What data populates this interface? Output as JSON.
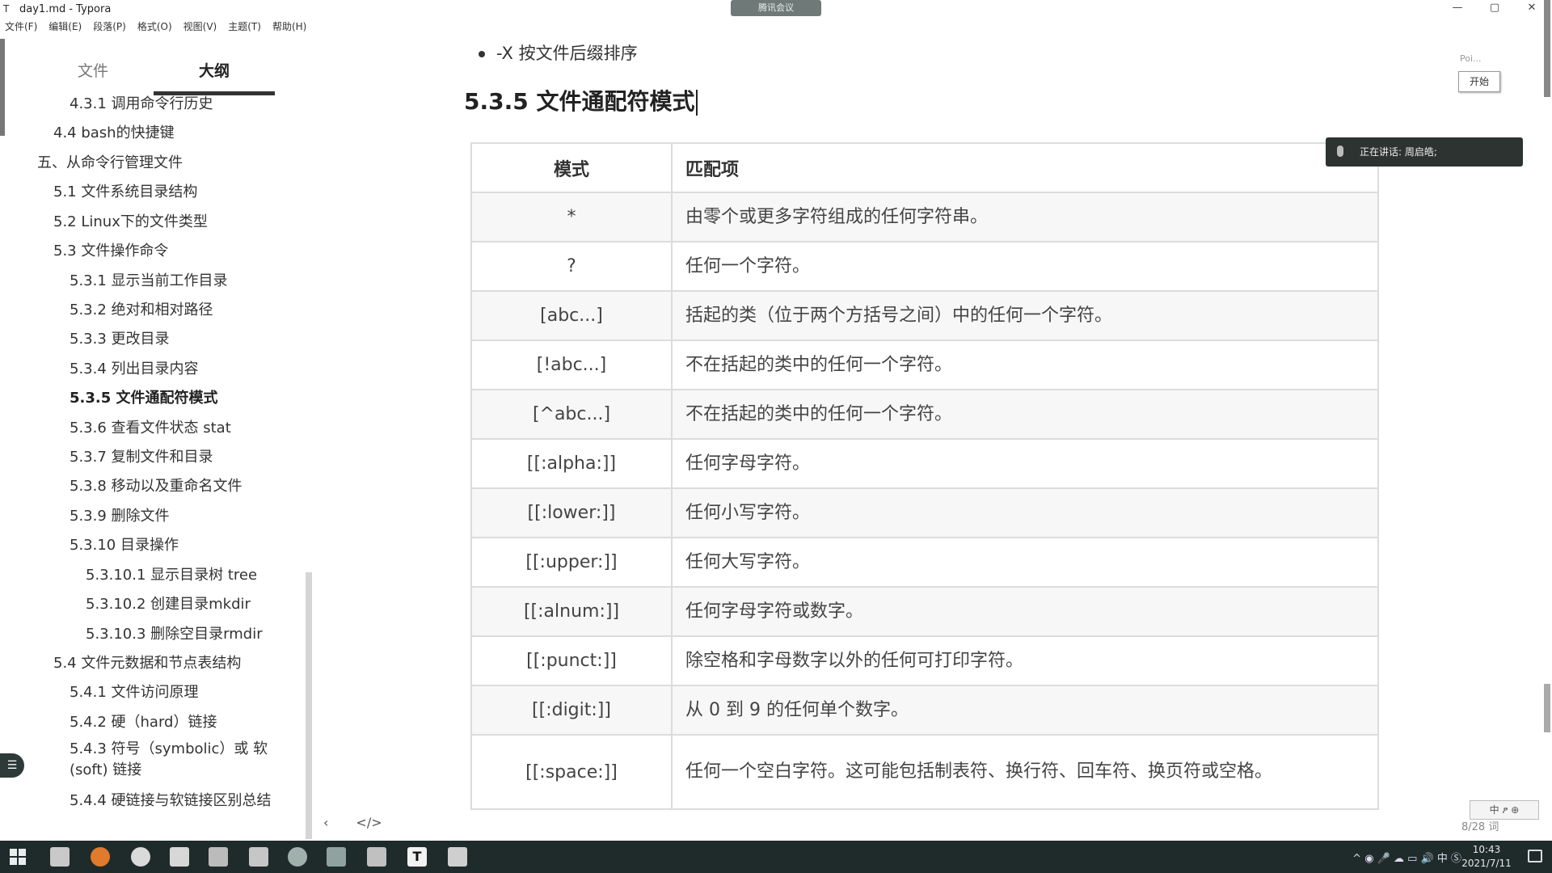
{
  "window": {
    "title": "day1.md - Typora",
    "meeting_pill": "腾讯会议",
    "controls": {
      "minimize": "—",
      "maximize": "▢",
      "close": "✕"
    }
  },
  "menu": [
    "文件(F)",
    "编辑(E)",
    "段落(P)",
    "格式(O)",
    "视图(V)",
    "主题(T)",
    "帮助(H)"
  ],
  "sidebar": {
    "tabs": [
      "文件",
      "大纲"
    ],
    "outline": [
      "4.3.1 调用命令行历史",
      "4.4 bash的快捷键",
      "五、从命令行管理文件",
      "5.1 文件系统目录结构",
      "5.2 Linux下的文件类型",
      "5.3 文件操作命令",
      "5.3.1 显示当前工作目录",
      "5.3.2 绝对和相对路径",
      "5.3.3 更改目录",
      "5.3.4 列出目录内容",
      "5.3.5 文件通配符模式",
      "5.3.6 查看文件状态 stat",
      "5.3.7 复制文件和目录",
      "5.3.8 移动以及重命名文件",
      "5.3.9 删除文件",
      "5.3.10 目录操作",
      "5.3.10.1 显示目录树 tree",
      "5.3.10.2 创建目录mkdir",
      "5.3.10.3 删除空目录rmdir",
      "5.4 文件元数据和节点表结构",
      "5.4.1 文件访问原理",
      "5.4.2 硬（hard）链接",
      "5.4.3 符号（symbolic）或 软(soft) 链接",
      "5.4.4 硬链接与软链接区别总结"
    ],
    "footer": {
      "back": "‹",
      "source": "</>"
    }
  },
  "editor": {
    "bullet": "-X 按文件后缀排序",
    "heading": "5.3.5 文件通配符模式",
    "table": {
      "headers": [
        "模式",
        "匹配项"
      ],
      "rows": [
        [
          "*",
          "由零个或更多字符组成的任何字符串。"
        ],
        [
          "?",
          "任何一个字符。"
        ],
        [
          "[abc...]",
          "括起的类（位于两个方括号之间）中的任何一个字符。"
        ],
        [
          "[!abc...]",
          "不在括起的类中的任何一个字符。"
        ],
        [
          "[^abc...]",
          "不在括起的类中的任何一个字符。"
        ],
        [
          "[[:alpha:]]",
          "任何字母字符。"
        ],
        [
          "[[:lower:]]",
          "任何小写字符。"
        ],
        [
          "[[:upper:]]",
          "任何大写字符。"
        ],
        [
          "[[:alnum:]]",
          "任何字母字符或数字。"
        ],
        [
          "[[:punct:]]",
          "除空格和字母数字以外的任何可打印字符。"
        ],
        [
          "[[:digit:]]",
          "从 0 到 9 的任何单个数字。"
        ],
        [
          "[[:space:]]",
          "任何一个空白字符。这可能包括制表符、换行符、回车符、换页符或空格。"
        ]
      ]
    }
  },
  "overlay": {
    "poi": "Poi...",
    "start_button": "开始",
    "speaking": "正在讲话: 周启皓;",
    "word_count": "8/28 词",
    "ime": "中 ፆ ⊕"
  },
  "taskbar": {
    "tray": "^  ◉  🎤  ☁  ▭  🔊  中  Ⓢ",
    "time": "10:43",
    "date": "2021/7/11"
  }
}
